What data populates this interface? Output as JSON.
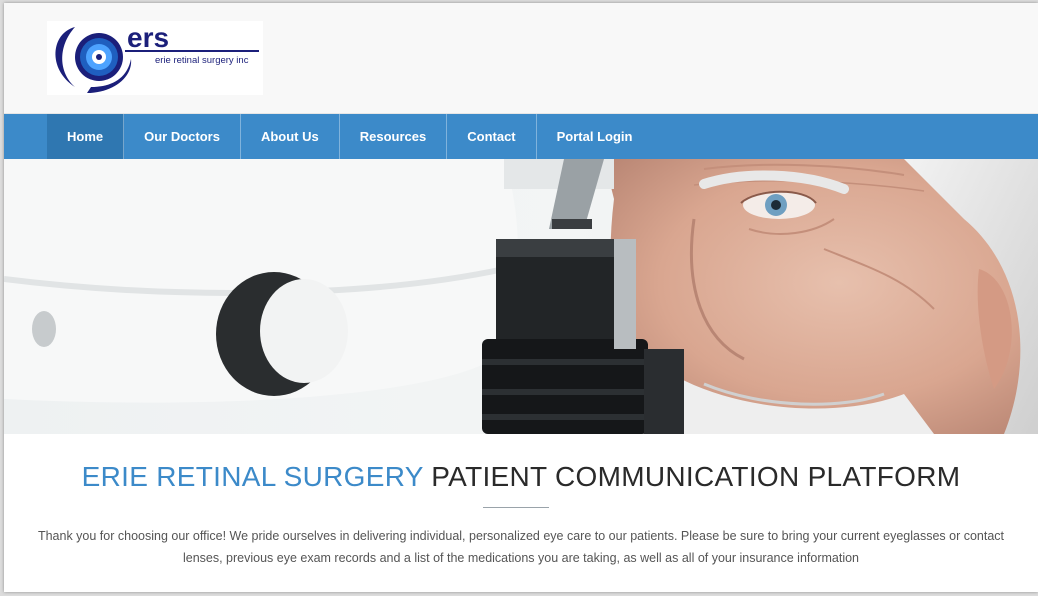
{
  "logo": {
    "letters": "ers",
    "tagline": "erie retinal surgery inc"
  },
  "nav": {
    "items": [
      {
        "label": "Home",
        "active": true
      },
      {
        "label": "Our Doctors"
      },
      {
        "label": "About Us"
      },
      {
        "label": "Resources"
      },
      {
        "label": "Contact"
      },
      {
        "label": "Portal Login"
      }
    ]
  },
  "hero": {
    "image": "eye-exam-photo"
  },
  "main": {
    "headline_accent": "ERIE RETINAL SURGERY",
    "headline_rest": " PATIENT COMMUNICATION PLATFORM",
    "intro": "Thank you for choosing our office! We pride ourselves in delivering individual, personalized eye care to our patients. Please be sure to bring your current eyeglasses or contact lenses, previous eye exam records and a list of the medications you are taking, as well as all of your insurance information"
  },
  "colors": {
    "nav_bg": "#3c8ac9",
    "nav_active": "#2f77b1",
    "accent": "#3c8ac9",
    "logo_navy": "#1b1f7a"
  }
}
